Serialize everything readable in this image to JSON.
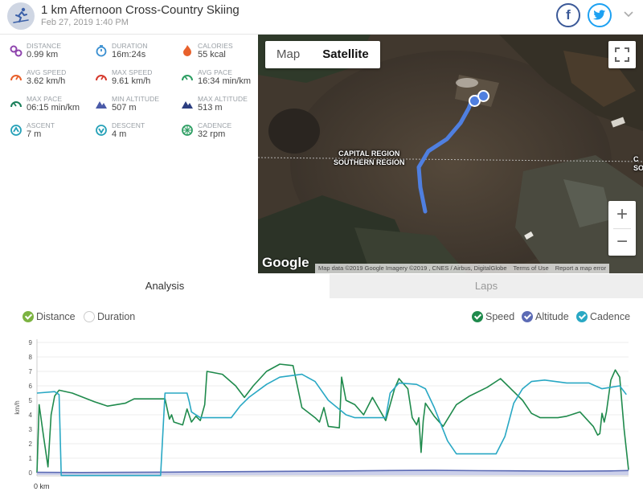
{
  "header": {
    "title": "1 km Afternoon Cross-Country Skiing",
    "date": "Feb 27, 2019 1:40 PM"
  },
  "stats": [
    {
      "label": "DISTANCE",
      "value": "0.99 km",
      "icon": "distance-icon",
      "color": "#8e44ad"
    },
    {
      "label": "DURATION",
      "value": "16m:24s",
      "icon": "stopwatch-icon",
      "color": "#3a8fd1"
    },
    {
      "label": "CALORIES",
      "value": "55 kcal",
      "icon": "flame-icon",
      "color": "#e8612c"
    },
    {
      "label": "AVG SPEED",
      "value": "3.62 km/h",
      "icon": "speedometer-icon",
      "color": "#e8612c"
    },
    {
      "label": "MAX SPEED",
      "value": "9.61 km/h",
      "icon": "speedometer-icon",
      "color": "#d63b2f"
    },
    {
      "label": "AVG PACE",
      "value": "16:34 min/km",
      "icon": "pace-gauge-icon",
      "color": "#2e9e63"
    },
    {
      "label": "MAX PACE",
      "value": "06:15 min/km",
      "icon": "pace-gauge-icon",
      "color": "#1a7f5a"
    },
    {
      "label": "MIN ALTITUDE",
      "value": "507 m",
      "icon": "mountain-icon",
      "color": "#4a5aa8"
    },
    {
      "label": "MAX ALTITUDE",
      "value": "513 m",
      "icon": "mountain-icon",
      "color": "#2c3e80"
    },
    {
      "label": "ASCENT",
      "value": "7 m",
      "icon": "ascent-icon",
      "color": "#26a1b8"
    },
    {
      "label": "DESCENT",
      "value": "4 m",
      "icon": "descent-icon",
      "color": "#26a1b8"
    },
    {
      "label": "CADENCE",
      "value": "32 rpm",
      "icon": "cadence-icon",
      "color": "#2e9e63"
    }
  ],
  "map": {
    "type_map": "Map",
    "type_satellite": "Satellite",
    "region_label_1": "CAPITAL REGION",
    "region_label_2": "SOUTHERN REGION",
    "region_label_right_1": "C",
    "region_label_right_2": "SO",
    "zoom_in": "+",
    "zoom_out": "−",
    "google_logo": "Google",
    "attribution": "Map data ©2019 Google Imagery ©2019 , CNES / Airbus, DigitalGlobe",
    "terms": "Terms of Use",
    "report": "Report a map error",
    "route_color": "#4f7fe0"
  },
  "tabs": {
    "analysis": "Analysis",
    "laps": "Laps"
  },
  "analysis": {
    "x_toggle": [
      {
        "label": "Distance",
        "checked": true,
        "color": "#7cb342"
      },
      {
        "label": "Duration",
        "checked": false,
        "color": "#cccccc"
      }
    ],
    "series_toggle": [
      {
        "label": "Speed",
        "checked": true,
        "color": "#1f8a4c"
      },
      {
        "label": "Altitude",
        "checked": true,
        "color": "#5c6bb5"
      },
      {
        "label": "Cadence",
        "checked": true,
        "color": "#29a8c4"
      }
    ]
  },
  "chart_data": {
    "type": "line",
    "ylabel": "km/h",
    "ylim": [
      0,
      9
    ],
    "yticks": [
      "0",
      "1",
      "2",
      "3",
      "4",
      "5",
      "6",
      "7",
      "8",
      "9"
    ],
    "xticks": [
      "0 km"
    ],
    "series": [
      {
        "name": "Speed",
        "color": "#1f8a4c",
        "points": [
          [
            0,
            0.0
          ],
          [
            0.005,
            4.7
          ],
          [
            0.015,
            2.5
          ],
          [
            0.025,
            0.4
          ],
          [
            0.032,
            4.0
          ],
          [
            0.04,
            5.3
          ],
          [
            0.05,
            5.7
          ],
          [
            0.08,
            5.5
          ],
          [
            0.13,
            4.9
          ],
          [
            0.16,
            4.6
          ],
          [
            0.2,
            4.8
          ],
          [
            0.22,
            5.1
          ],
          [
            0.29,
            5.1
          ],
          [
            0.3,
            3.7
          ],
          [
            0.305,
            4.0
          ],
          [
            0.31,
            3.5
          ],
          [
            0.33,
            3.3
          ],
          [
            0.34,
            4.4
          ],
          [
            0.35,
            3.5
          ],
          [
            0.36,
            3.9
          ],
          [
            0.37,
            3.6
          ],
          [
            0.38,
            4.7
          ],
          [
            0.385,
            7.0
          ],
          [
            0.42,
            6.8
          ],
          [
            0.45,
            6.0
          ],
          [
            0.47,
            5.2
          ],
          [
            0.49,
            6.0
          ],
          [
            0.52,
            7.0
          ],
          [
            0.55,
            7.5
          ],
          [
            0.58,
            7.4
          ],
          [
            0.6,
            4.5
          ],
          [
            0.63,
            3.8
          ],
          [
            0.64,
            3.5
          ],
          [
            0.65,
            4.5
          ],
          [
            0.66,
            3.2
          ],
          [
            0.685,
            3.1
          ],
          [
            0.69,
            6.6
          ],
          [
            0.7,
            5.0
          ],
          [
            0.72,
            4.7
          ],
          [
            0.74,
            4.0
          ],
          [
            0.76,
            5.2
          ],
          [
            0.79,
            3.6
          ],
          [
            0.81,
            5.8
          ],
          [
            0.82,
            6.5
          ],
          [
            0.84,
            5.8
          ],
          [
            0.85,
            3.8
          ],
          [
            0.86,
            3.3
          ],
          [
            0.865,
            3.8
          ],
          [
            0.87,
            1.4
          ],
          [
            0.875,
            3.6
          ],
          [
            0.88,
            4.8
          ],
          [
            0.9,
            3.9
          ],
          [
            0.92,
            3.2
          ],
          [
            0.95,
            4.7
          ],
          [
            0.98,
            5.3
          ],
          [
            1.02,
            5.9
          ],
          [
            1.05,
            6.5
          ],
          [
            1.08,
            5.6
          ],
          [
            1.1,
            5.0
          ],
          [
            1.12,
            4.1
          ],
          [
            1.14,
            3.8
          ],
          [
            1.18,
            3.8
          ],
          [
            1.2,
            3.9
          ],
          [
            1.23,
            4.2
          ],
          [
            1.26,
            3.2
          ],
          [
            1.27,
            2.6
          ],
          [
            1.275,
            2.7
          ],
          [
            1.28,
            4.1
          ],
          [
            1.285,
            3.5
          ],
          [
            1.29,
            4.2
          ],
          [
            1.3,
            6.4
          ],
          [
            1.31,
            7.1
          ],
          [
            1.32,
            6.6
          ],
          [
            1.33,
            3.0
          ],
          [
            1.34,
            0.2
          ]
        ]
      },
      {
        "name": "Altitude",
        "color": "#5c6bb5",
        "points": [
          [
            0,
            0.02
          ],
          [
            0.1,
            0.01
          ],
          [
            0.2,
            0.02
          ],
          [
            0.3,
            0.04
          ],
          [
            0.4,
            0.06
          ],
          [
            0.5,
            0.08
          ],
          [
            0.6,
            0.1
          ],
          [
            0.7,
            0.12
          ],
          [
            0.8,
            0.15
          ],
          [
            0.9,
            0.16
          ],
          [
            1.0,
            0.14
          ],
          [
            1.1,
            0.12
          ],
          [
            1.2,
            0.1
          ],
          [
            1.3,
            0.12
          ],
          [
            1.34,
            0.15
          ]
        ]
      },
      {
        "name": "Cadence",
        "color": "#29a8c4",
        "points": [
          [
            0,
            5.5
          ],
          [
            0.04,
            5.6
          ],
          [
            0.05,
            5.4
          ],
          [
            0.055,
            -0.2
          ],
          [
            0.15,
            -0.2
          ],
          [
            0.28,
            -0.2
          ],
          [
            0.29,
            5.5
          ],
          [
            0.34,
            5.5
          ],
          [
            0.345,
            4.9
          ],
          [
            0.35,
            4.2
          ],
          [
            0.37,
            3.8
          ],
          [
            0.44,
            3.8
          ],
          [
            0.46,
            4.6
          ],
          [
            0.48,
            5.2
          ],
          [
            0.52,
            6.1
          ],
          [
            0.55,
            6.6
          ],
          [
            0.6,
            6.8
          ],
          [
            0.63,
            6.3
          ],
          [
            0.66,
            5.0
          ],
          [
            0.7,
            4.0
          ],
          [
            0.72,
            3.8
          ],
          [
            0.79,
            3.8
          ],
          [
            0.8,
            5.5
          ],
          [
            0.82,
            6.2
          ],
          [
            0.86,
            6.1
          ],
          [
            0.88,
            5.8
          ],
          [
            0.9,
            4.5
          ],
          [
            0.93,
            2.2
          ],
          [
            0.95,
            1.3
          ],
          [
            1.04,
            1.3
          ],
          [
            1.06,
            2.5
          ],
          [
            1.08,
            4.8
          ],
          [
            1.1,
            5.8
          ],
          [
            1.12,
            6.3
          ],
          [
            1.15,
            6.4
          ],
          [
            1.2,
            6.2
          ],
          [
            1.25,
            6.2
          ],
          [
            1.28,
            5.8
          ],
          [
            1.3,
            5.9
          ],
          [
            1.32,
            6.0
          ],
          [
            1.335,
            5.4
          ]
        ]
      }
    ]
  }
}
